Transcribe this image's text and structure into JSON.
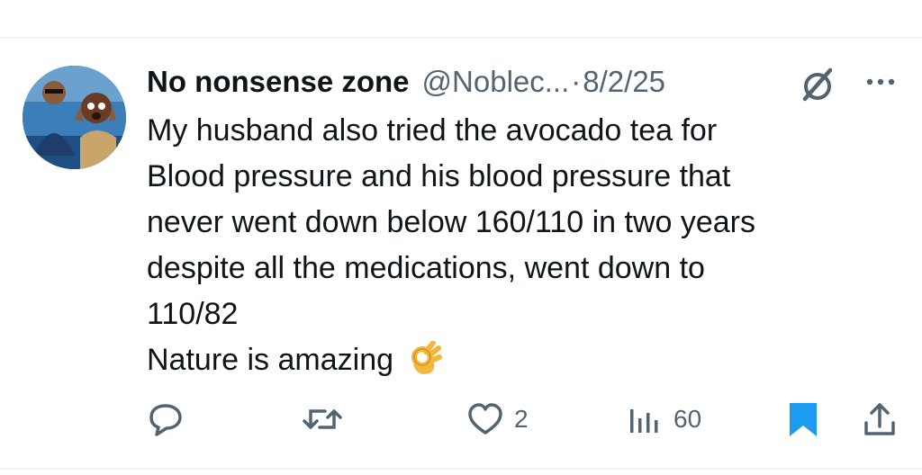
{
  "post": {
    "author_name": "No nonsense zone",
    "author_handle": "@Noblec...",
    "separator": "·",
    "date": "8/2/25",
    "body_lines": [
      "My husband also tried the avocado tea for",
      "Blood pressure and his blood pressure that",
      "never went down below 160/110 in two years",
      "despite all the medications, went down to",
      "110/82",
      "Nature is amazing"
    ],
    "emoji": "ok-hand-emoji"
  },
  "actions": {
    "reply_count": "",
    "repost_count": "",
    "like_count": "2",
    "views_count": "60"
  },
  "colors": {
    "text": "#0f1419",
    "secondary": "#536471",
    "accent": "#1d9bf0",
    "divider": "#eff3f4"
  }
}
